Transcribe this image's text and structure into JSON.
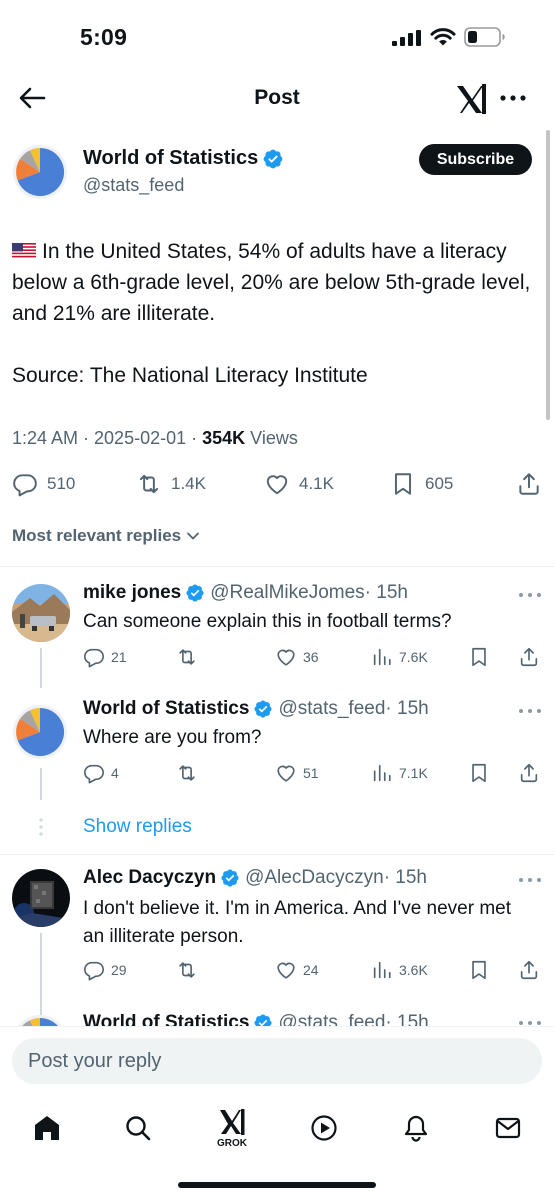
{
  "status_bar": {
    "time": "5:09",
    "icons": [
      "cellular-signal-icon",
      "wifi-icon",
      "battery-icon"
    ]
  },
  "nav": {
    "title": "Post",
    "back_icon": "arrow-left-icon",
    "grok_icon": "grok-icon",
    "more_icon": "more-icon"
  },
  "post": {
    "author_name": "World of Statistics",
    "handle": "@stats_feed",
    "subscribe_label": "Subscribe",
    "text_line_1": "In the United States, 54% of adults have a literacy below a 6th-grade level, 20% are below 5th-grade level, and 21% are illiterate.",
    "text_line_2": "Source: The National Literacy Institute",
    "flag": "us-flag-icon",
    "meta": "1:24 AM · 2025-02-01 · ",
    "views_count": "354K",
    "views_label": "Views",
    "actions": {
      "replies": "510",
      "reposts": "1.4K",
      "likes": "4.1K",
      "bookmarks": "605"
    }
  },
  "replies_sort_label": "Most relevant replies",
  "replies": [
    {
      "name": "mike jones",
      "handle": "@RealMikeJomes",
      "time": "· 15h",
      "text": "Can someone explain this in football terms?",
      "replies": "21",
      "likes": "36",
      "views": "7.6K"
    },
    {
      "name": "World of Statistics",
      "handle": "@stats_feed",
      "time": "· 15h",
      "text": "Where are you from?",
      "replies": "4",
      "likes": "51",
      "views": "7.1K"
    },
    {
      "name": "Alec Dacyczyn",
      "handle": "@AlecDacyczyn",
      "time": "· 15h",
      "text": "I don't believe it. I'm in America. And I've never met an illiterate person.",
      "replies": "29",
      "likes": "24",
      "views": "3.6K"
    },
    {
      "name": "World of Statistics",
      "handle": "@stats_feed",
      "time": "· 15h"
    }
  ],
  "show_replies_label": "Show replies",
  "composer": {
    "placeholder": "Post your reply"
  },
  "tab_bar": {
    "items": [
      "home-icon",
      "search-icon",
      "grok-icon",
      "video-icon",
      "notifications-icon",
      "messages-icon"
    ],
    "grok_label": "GROK"
  },
  "colors": {
    "text": "#0f1419",
    "secondary": "#536471",
    "accent": "#1d9bf0",
    "verified": "#1d9bf0",
    "pie_blue": "#4a7fd6",
    "pie_orange": "#f07f3a",
    "pie_gray": "#a5a5a5",
    "pie_yellow": "#f5c02f"
  }
}
